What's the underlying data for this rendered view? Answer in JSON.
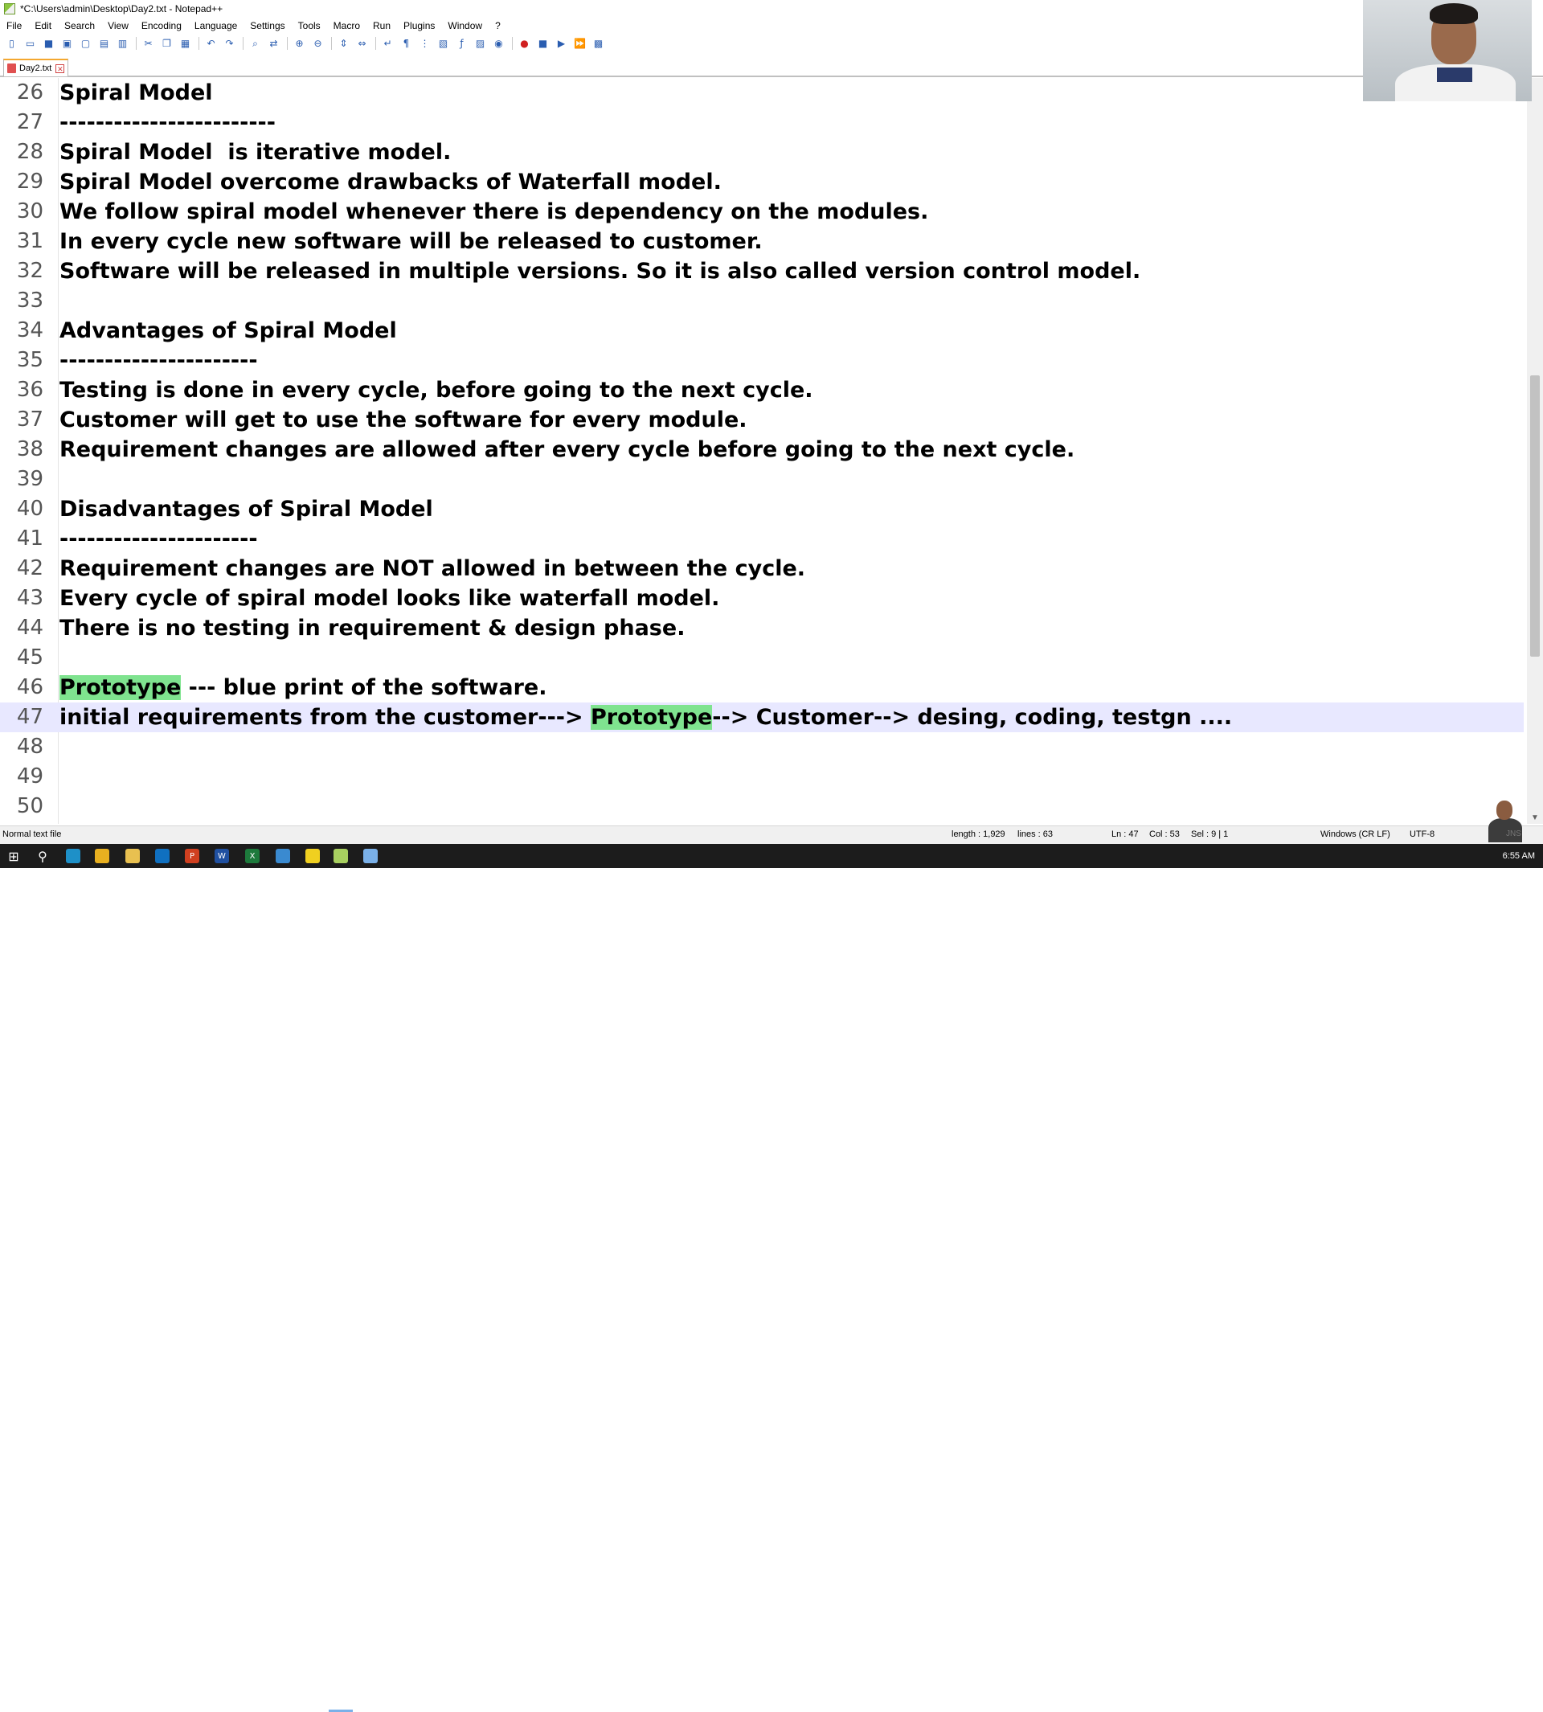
{
  "window": {
    "title": "*C:\\Users\\admin\\Desktop\\Day2.txt - Notepad++"
  },
  "menu": [
    "File",
    "Edit",
    "Search",
    "View",
    "Encoding",
    "Language",
    "Settings",
    "Tools",
    "Macro",
    "Run",
    "Plugins",
    "Window",
    "?"
  ],
  "toolbar_icons": [
    "new-file-icon",
    "open-file-icon",
    "save-icon",
    "save-all-icon",
    "close-icon",
    "close-all-icon",
    "print-icon",
    "cut-icon",
    "copy-icon",
    "paste-icon",
    "undo-icon",
    "redo-icon",
    "find-icon",
    "replace-icon",
    "zoom-in-icon",
    "zoom-out-icon",
    "sync-vertical-icon",
    "sync-horizontal-icon",
    "word-wrap-icon",
    "show-all-chars-icon",
    "indent-guide-icon",
    "doc-map-icon",
    "function-list-icon",
    "folder-workspace-icon",
    "monitoring-icon",
    "record-macro-icon",
    "stop-record-icon",
    "playback-icon",
    "run-macro-multiple-icon",
    "save-macro-icon"
  ],
  "tab": {
    "label": "Day2.txt"
  },
  "editor": {
    "current_line": 47,
    "lines": [
      {
        "num": "26",
        "text": "Spiral Model"
      },
      {
        "num": "27",
        "text": "------------------------"
      },
      {
        "num": "28",
        "text": "Spiral Model  is iterative model."
      },
      {
        "num": "29",
        "text": "Spiral Model overcome drawbacks of Waterfall model."
      },
      {
        "num": "30",
        "text": "We follow spiral model whenever there is dependency on the modules."
      },
      {
        "num": "31",
        "text": "In every cycle new software will be released to customer."
      },
      {
        "num": "32",
        "text": "Software will be released in multiple versions. So it is also called version control model."
      },
      {
        "num": "33",
        "text": ""
      },
      {
        "num": "34",
        "text": "Advantages of Spiral Model"
      },
      {
        "num": "35",
        "text": "----------------------"
      },
      {
        "num": "36",
        "text": "Testing is done in every cycle, before going to the next cycle."
      },
      {
        "num": "37",
        "text": "Customer will get to use the software for every module."
      },
      {
        "num": "38",
        "text": "Requirement changes are allowed after every cycle before going to the next cycle."
      },
      {
        "num": "39",
        "text": ""
      },
      {
        "num": "40",
        "text": "Disadvantages of Spiral Model"
      },
      {
        "num": "41",
        "text": "----------------------"
      },
      {
        "num": "42",
        "text": "Requirement changes are NOT allowed in between the cycle."
      },
      {
        "num": "43",
        "text": "Every cycle of spiral model looks like waterfall model."
      },
      {
        "num": "44",
        "text": "There is no testing in requirement & design phase."
      },
      {
        "num": "45",
        "text": ""
      },
      {
        "num": "46",
        "text_parts": [
          {
            "t": "Prototype",
            "hl": true
          },
          {
            "t": " --- blue print of the software.",
            "hl": false
          }
        ]
      },
      {
        "num": "47",
        "text_parts": [
          {
            "t": "initial requirements from the customer---> ",
            "hl": false
          },
          {
            "t": "Prototype",
            "hl": true
          },
          {
            "t": "--> Customer--> desing, coding, testgn ....",
            "hl": false
          }
        ]
      },
      {
        "num": "48",
        "text": ""
      },
      {
        "num": "49",
        "text": ""
      },
      {
        "num": "50",
        "text": ""
      }
    ],
    "highlight_color": "#7fe38f",
    "current_line_color": "#e8e8ff"
  },
  "status": {
    "file_type": "Normal text file",
    "length": "length : 1,929",
    "lines": "lines : 63",
    "ln": "Ln : 47",
    "col": "Col : 53",
    "sel": "Sel : 9 | 1",
    "eol": "Windows (CR LF)",
    "encoding": "UTF-8"
  },
  "taskbar": {
    "icons": [
      "windows-start-icon",
      "search-icon",
      "edge-icon",
      "chrome-icon",
      "file-explorer-icon",
      "outlook-icon",
      "powerpoint-icon",
      "word-icon",
      "excel-icon",
      "webex-icon",
      "sticky-notes-icon",
      "notepad-plus-plus-icon",
      "notepad-icon"
    ],
    "clock": "6:55 AM"
  },
  "overlay": {
    "brand": "JNS"
  }
}
